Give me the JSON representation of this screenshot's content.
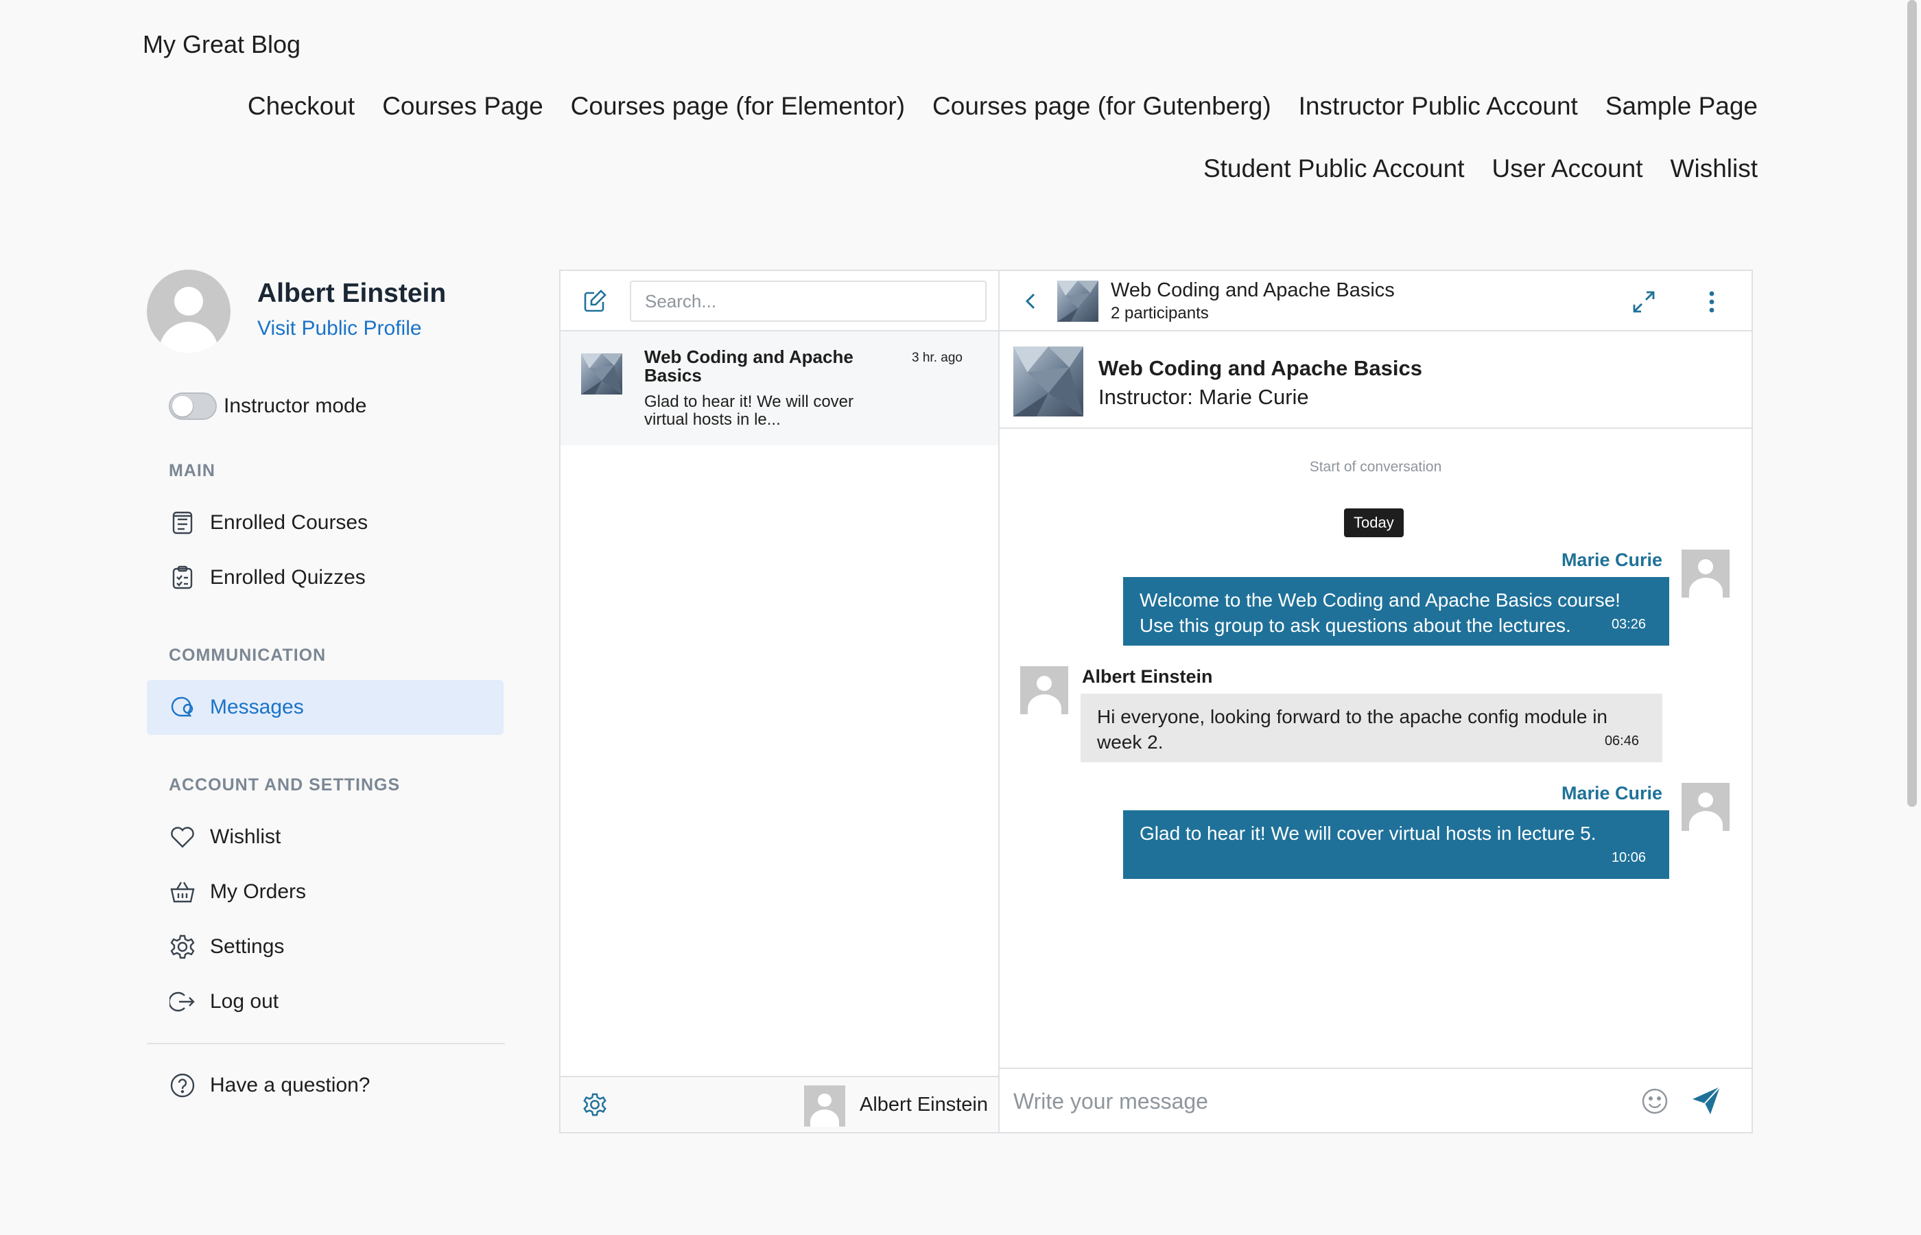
{
  "site": {
    "title": "My Great Blog"
  },
  "nav": {
    "row1": [
      "Checkout",
      "Courses Page",
      "Courses page (for Elementor)",
      "Courses page (for Gutenberg)",
      "Instructor Public Account",
      "Sample Page"
    ],
    "row2": [
      "Student Public Account",
      "User Account",
      "Wishlist"
    ]
  },
  "profile": {
    "name": "Albert Einstein",
    "link": "Visit Public Profile"
  },
  "instructor_mode": {
    "label": "Instructor mode",
    "enabled": false
  },
  "sidebar": {
    "main": {
      "heading": "MAIN",
      "items": [
        {
          "label": "Enrolled Courses",
          "icon": "courses-icon"
        },
        {
          "label": "Enrolled Quizzes",
          "icon": "quizzes-icon"
        }
      ]
    },
    "communication": {
      "heading": "COMMUNICATION",
      "items": [
        {
          "label": "Messages",
          "icon": "messages-icon",
          "active": true
        }
      ]
    },
    "account": {
      "heading": "ACCOUNT AND SETTINGS",
      "items": [
        {
          "label": "Wishlist",
          "icon": "heart-icon"
        },
        {
          "label": "My Orders",
          "icon": "basket-icon"
        },
        {
          "label": "Settings",
          "icon": "gear-icon"
        },
        {
          "label": "Log out",
          "icon": "logout-icon"
        }
      ]
    },
    "help": {
      "label": "Have a question?",
      "icon": "question-icon"
    }
  },
  "chat": {
    "search": {
      "placeholder": "Search...",
      "value": ""
    },
    "threads": [
      {
        "title": "Web Coding and Apache Basics",
        "time": "3 hr. ago",
        "snippet": "Glad to hear it! We will cover virtual hosts in le..."
      }
    ],
    "footer_user": "Albert Einstein",
    "conversation": {
      "title": "Web Coding and Apache Basics",
      "participants": "2 participants",
      "card_title": "Web Coding and Apache Basics",
      "card_subtitle": "Instructor: Marie Curie",
      "start_label": "Start of conversation",
      "day_label": "Today",
      "messages": [
        {
          "sender": "Marie Curie",
          "text": "Welcome to the Web Coding and Apache Basics course! Use this group to ask questions about the lectures.",
          "time": "03:26",
          "outgoing": true
        },
        {
          "sender": "Albert Einstein",
          "text": "Hi everyone, looking forward to the apache config module in week 2.",
          "time": "06:46",
          "outgoing": false
        },
        {
          "sender": "Marie Curie",
          "text": "Glad to hear it! We will cover virtual hosts in lecture 5.",
          "time": "10:06",
          "outgoing": true
        }
      ]
    },
    "composer": {
      "placeholder": "Write your message",
      "value": ""
    }
  },
  "colors": {
    "accent": "#1a73c8",
    "bubble_out": "#1f7199",
    "bubble_in": "#e8e8e8",
    "active_bg": "#e3ecfb"
  }
}
